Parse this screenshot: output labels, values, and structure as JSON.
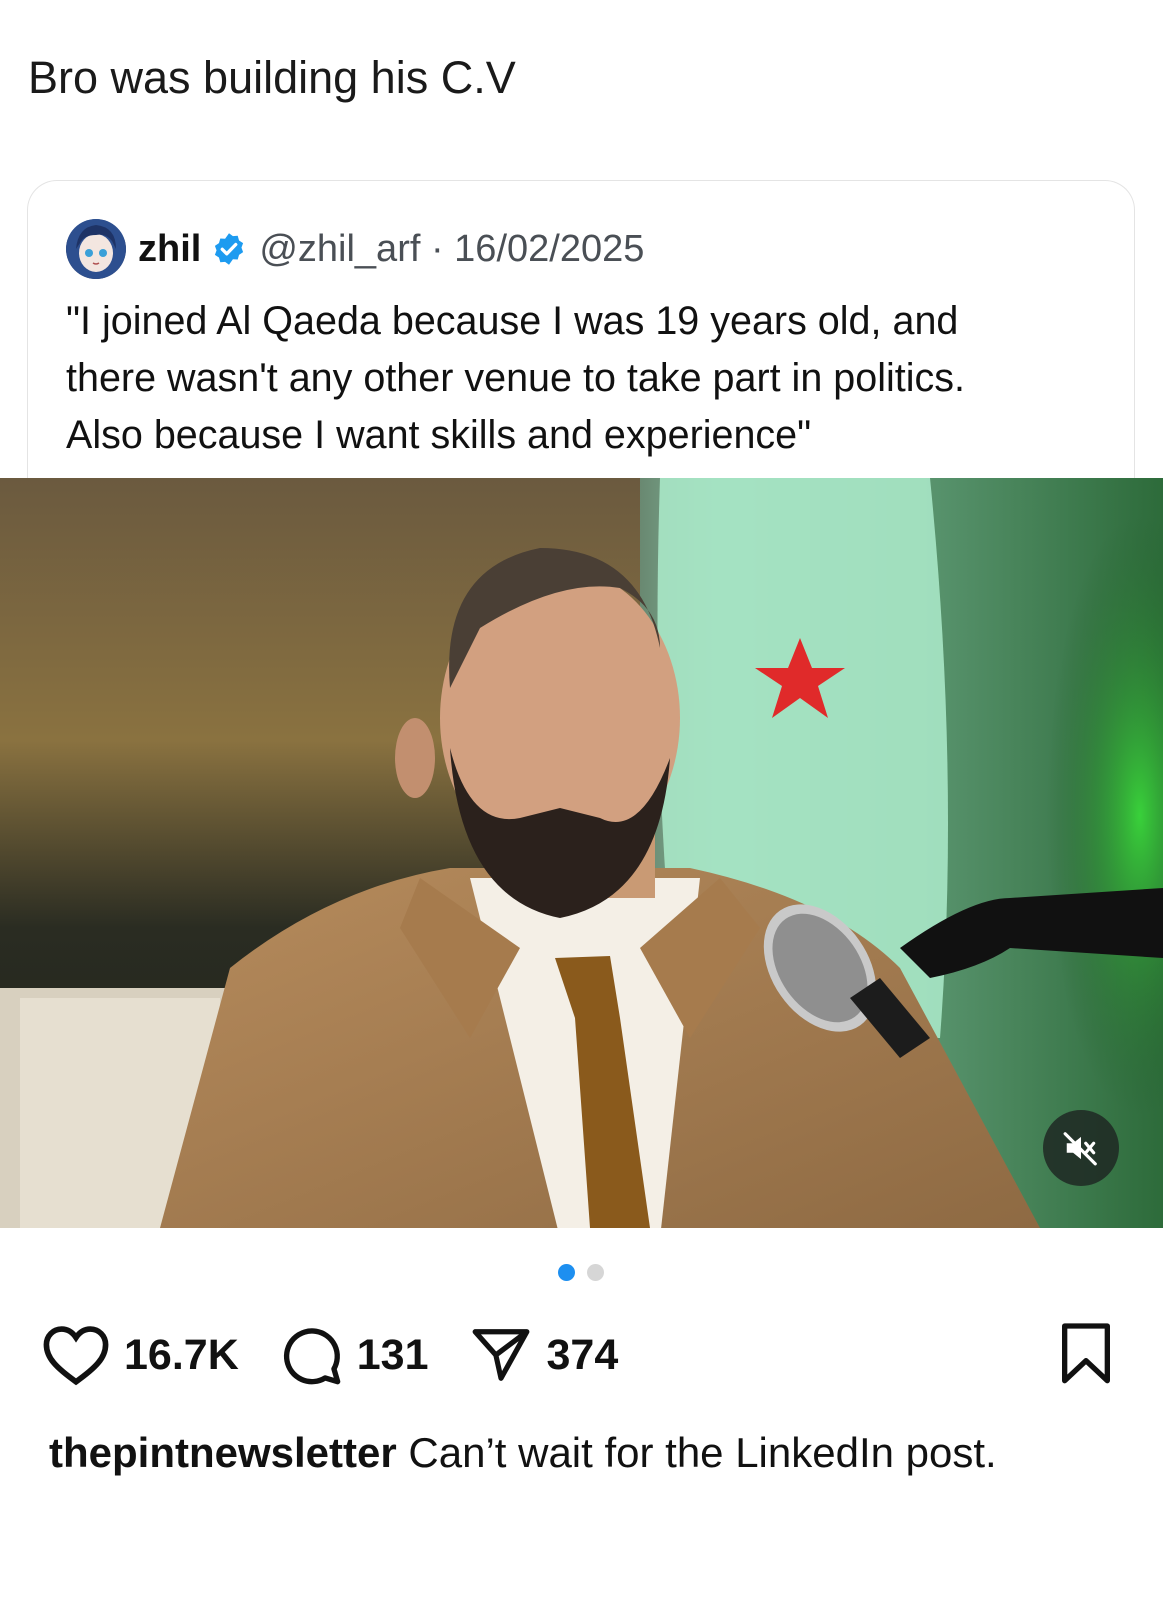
{
  "post": {
    "headline": "Bro was building his C.V",
    "quoted_tweet": {
      "name": "zhil",
      "handle_date": "@zhil_arf · 16/02/2025",
      "text_lines": [
        "\"I joined Al Qaeda because I was 19 years old, and",
        "there wasn't any other venue to take part in politics.",
        "Also because I want skills and experience\""
      ]
    },
    "carousel": {
      "total": 2,
      "active_index": 0
    },
    "stats": {
      "likes": "16.7K",
      "comments": "131",
      "shares": "374"
    },
    "caption": {
      "username": "thepintnewsletter",
      "text": "Can’t wait for the LinkedIn post."
    }
  },
  "colors": {
    "accent": "#1d8ff0",
    "verified": "#1d9bf0"
  },
  "icons": [
    "heart-icon",
    "comment-icon",
    "share-icon",
    "bookmark-icon",
    "verified-badge-icon",
    "muted-speaker-icon"
  ]
}
